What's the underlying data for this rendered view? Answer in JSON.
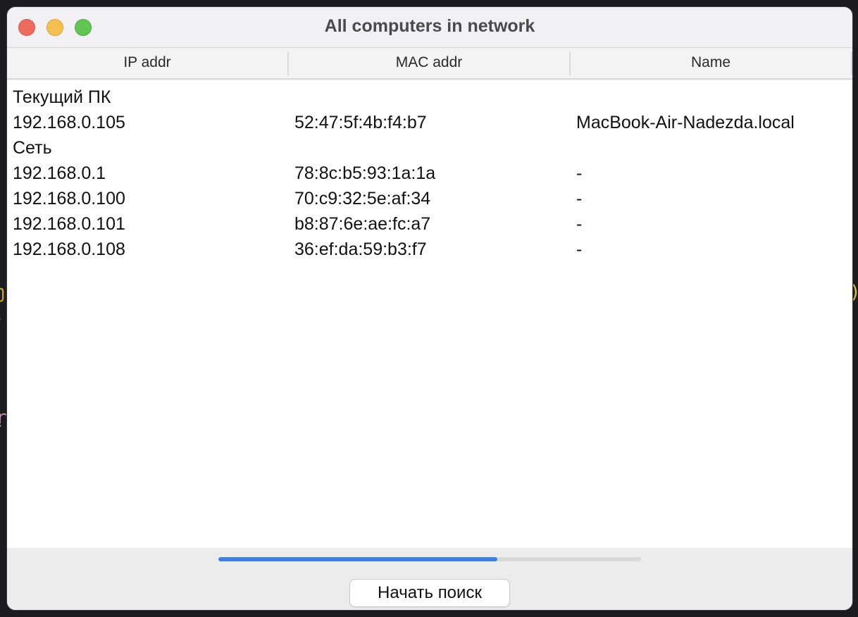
{
  "window": {
    "title": "All computers in network"
  },
  "table": {
    "columns": [
      "IP addr",
      "MAC addr",
      "Name"
    ],
    "rows": [
      {
        "type": "group",
        "label": "Текущий ПК"
      },
      {
        "type": "data",
        "ip": "192.168.0.105",
        "mac": "52:47:5f:4b:f4:b7",
        "name": "MacBook-Air-Nadezda.local"
      },
      {
        "type": "group",
        "label": "Сеть"
      },
      {
        "type": "data",
        "ip": "192.168.0.1",
        "mac": "78:8c:b5:93:1a:1a",
        "name": "-"
      },
      {
        "type": "data",
        "ip": "192.168.0.100",
        "mac": "70:c9:32:5e:af:34",
        "name": "-"
      },
      {
        "type": "data",
        "ip": "192.168.0.101",
        "mac": "b8:87:6e:ae:fc:a7",
        "name": "-"
      },
      {
        "type": "data",
        "ip": "192.168.0.108",
        "mac": "36:ef:da:59:b3:f7",
        "name": "-"
      }
    ]
  },
  "progress": {
    "fraction": 0.66,
    "color": "#3b82e8"
  },
  "search_button": {
    "label": "Начать поиск"
  },
  "colors": {
    "close": "#ee6a5e",
    "minimize": "#f5bf4f",
    "zoom": "#61c554"
  }
}
